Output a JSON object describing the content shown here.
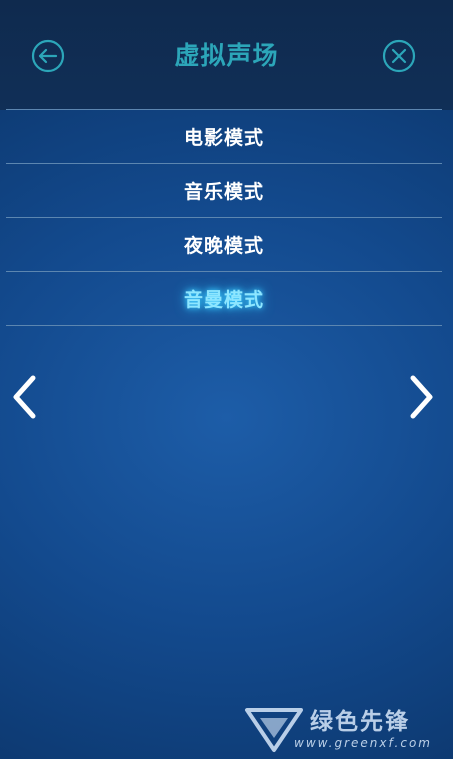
{
  "header": {
    "title": "虚拟声场",
    "back_icon": "arrow-left-circle-icon",
    "close_icon": "x-circle-icon",
    "title_color": "#2ca6b9"
  },
  "modes": [
    {
      "label": "电影模式",
      "selected": false
    },
    {
      "label": "音乐模式",
      "selected": false
    },
    {
      "label": "夜晚模式",
      "selected": false
    },
    {
      "label": "音曼模式",
      "selected": true
    }
  ],
  "navigation": {
    "prev_icon": "chevron-left-icon",
    "next_icon": "chevron-right-icon"
  },
  "watermark": {
    "name": "绿色先锋",
    "url": "www.greenxf.com"
  },
  "colors": {
    "accent": "#8de6ff",
    "background": "#134a8e"
  }
}
